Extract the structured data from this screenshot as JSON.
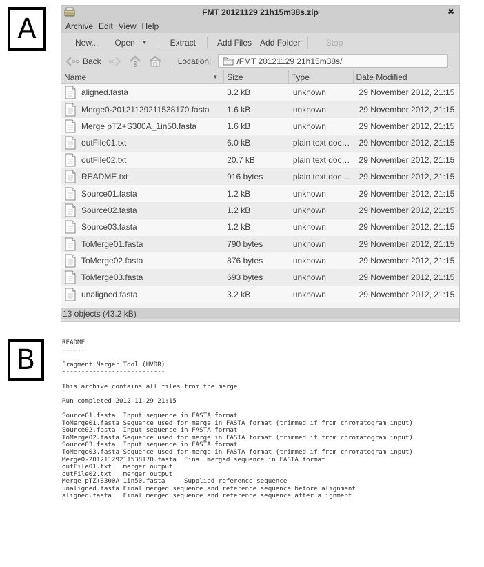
{
  "figure": {
    "panel_a_label": "A",
    "panel_b_label": "B"
  },
  "window": {
    "title": "FMT 20121129 21h15m38s.zip",
    "close_icon": "close-icon",
    "menu": [
      "Archive",
      "Edit",
      "View",
      "Help"
    ],
    "toolbar": {
      "new": "New...",
      "open": "Open",
      "extract": "Extract",
      "add_files": "Add Files",
      "add_folder": "Add Folder",
      "stop": "Stop"
    },
    "nav": {
      "back": "Back",
      "location_label": "Location:",
      "location_value": "/FMT 20121129 21h15m38s/"
    },
    "columns": {
      "name": "Name",
      "size": "Size",
      "type": "Type",
      "date": "Date Modified"
    },
    "files": [
      {
        "name": "aligned.fasta",
        "size": "3.2 kB",
        "type": "unknown",
        "date": "29 November 2012, 21:15"
      },
      {
        "name": "Merge0-20121129211538170.fasta",
        "size": "1.6 kB",
        "type": "unknown",
        "date": "29 November 2012, 21:15"
      },
      {
        "name": "Merge pTZ+S300A_1in50.fasta",
        "size": "1.6 kB",
        "type": "unknown",
        "date": "29 November 2012, 21:15"
      },
      {
        "name": "outFile01.txt",
        "size": "6.0 kB",
        "type": "plain text doc…",
        "date": "29 November 2012, 21:15"
      },
      {
        "name": "outFile02.txt",
        "size": "20.7 kB",
        "type": "plain text doc…",
        "date": "29 November 2012, 21:15"
      },
      {
        "name": "README.txt",
        "size": "916 bytes",
        "type": "plain text doc…",
        "date": "29 November 2012, 21:15"
      },
      {
        "name": "Source01.fasta",
        "size": "1.2 kB",
        "type": "unknown",
        "date": "29 November 2012, 21:15"
      },
      {
        "name": "Source02.fasta",
        "size": "1.2 kB",
        "type": "unknown",
        "date": "29 November 2012, 21:15"
      },
      {
        "name": "Source03.fasta",
        "size": "1.2 kB",
        "type": "unknown",
        "date": "29 November 2012, 21:15"
      },
      {
        "name": "ToMerge01.fasta",
        "size": "790 bytes",
        "type": "unknown",
        "date": "29 November 2012, 21:15"
      },
      {
        "name": "ToMerge02.fasta",
        "size": "876 bytes",
        "type": "unknown",
        "date": "29 November 2012, 21:15"
      },
      {
        "name": "ToMerge03.fasta",
        "size": "693 bytes",
        "type": "unknown",
        "date": "29 November 2012, 21:15"
      },
      {
        "name": "unaligned.fasta",
        "size": "3.2 kB",
        "type": "unknown",
        "date": "29 November 2012, 21:15"
      }
    ],
    "status": "13 objects (43.2 kB)"
  },
  "readme": {
    "lines": [
      "README",
      "------",
      "",
      "Fragment Merger Tool (HVDR)",
      "---------------------------",
      "",
      "This archive contains all files from the merge",
      "",
      "Run completed 2012-11-29 21:15",
      "",
      "Source01.fasta  Input sequence in FASTA format",
      "ToMerge01.fasta Sequence used for merge in FASTA format (trimmed if from chromatogram input)",
      "Source02.fasta  Input sequence in FASTA format",
      "ToMerge02.fasta Sequence used for merge in FASTA format (trimmed if from chromatogram input)",
      "Source03.fasta  Input sequence in FASTA format",
      "ToMerge03.fasta Sequence used for merge in FASTA format (trimmed if from chromatogram input)",
      "Merge0-20121129211538170.fasta  Final merged sequence in FASTA format",
      "outFile01.txt   merger output",
      "outFile02.txt   merger output",
      "Merge pTZ+S300A_1in50.fasta     Supplied reference sequence",
      "unaligned.fasta Final merged sequence and reference sequence before alignment",
      "aligned.fasta   Final merged sequence and reference sequence after alignment"
    ]
  }
}
